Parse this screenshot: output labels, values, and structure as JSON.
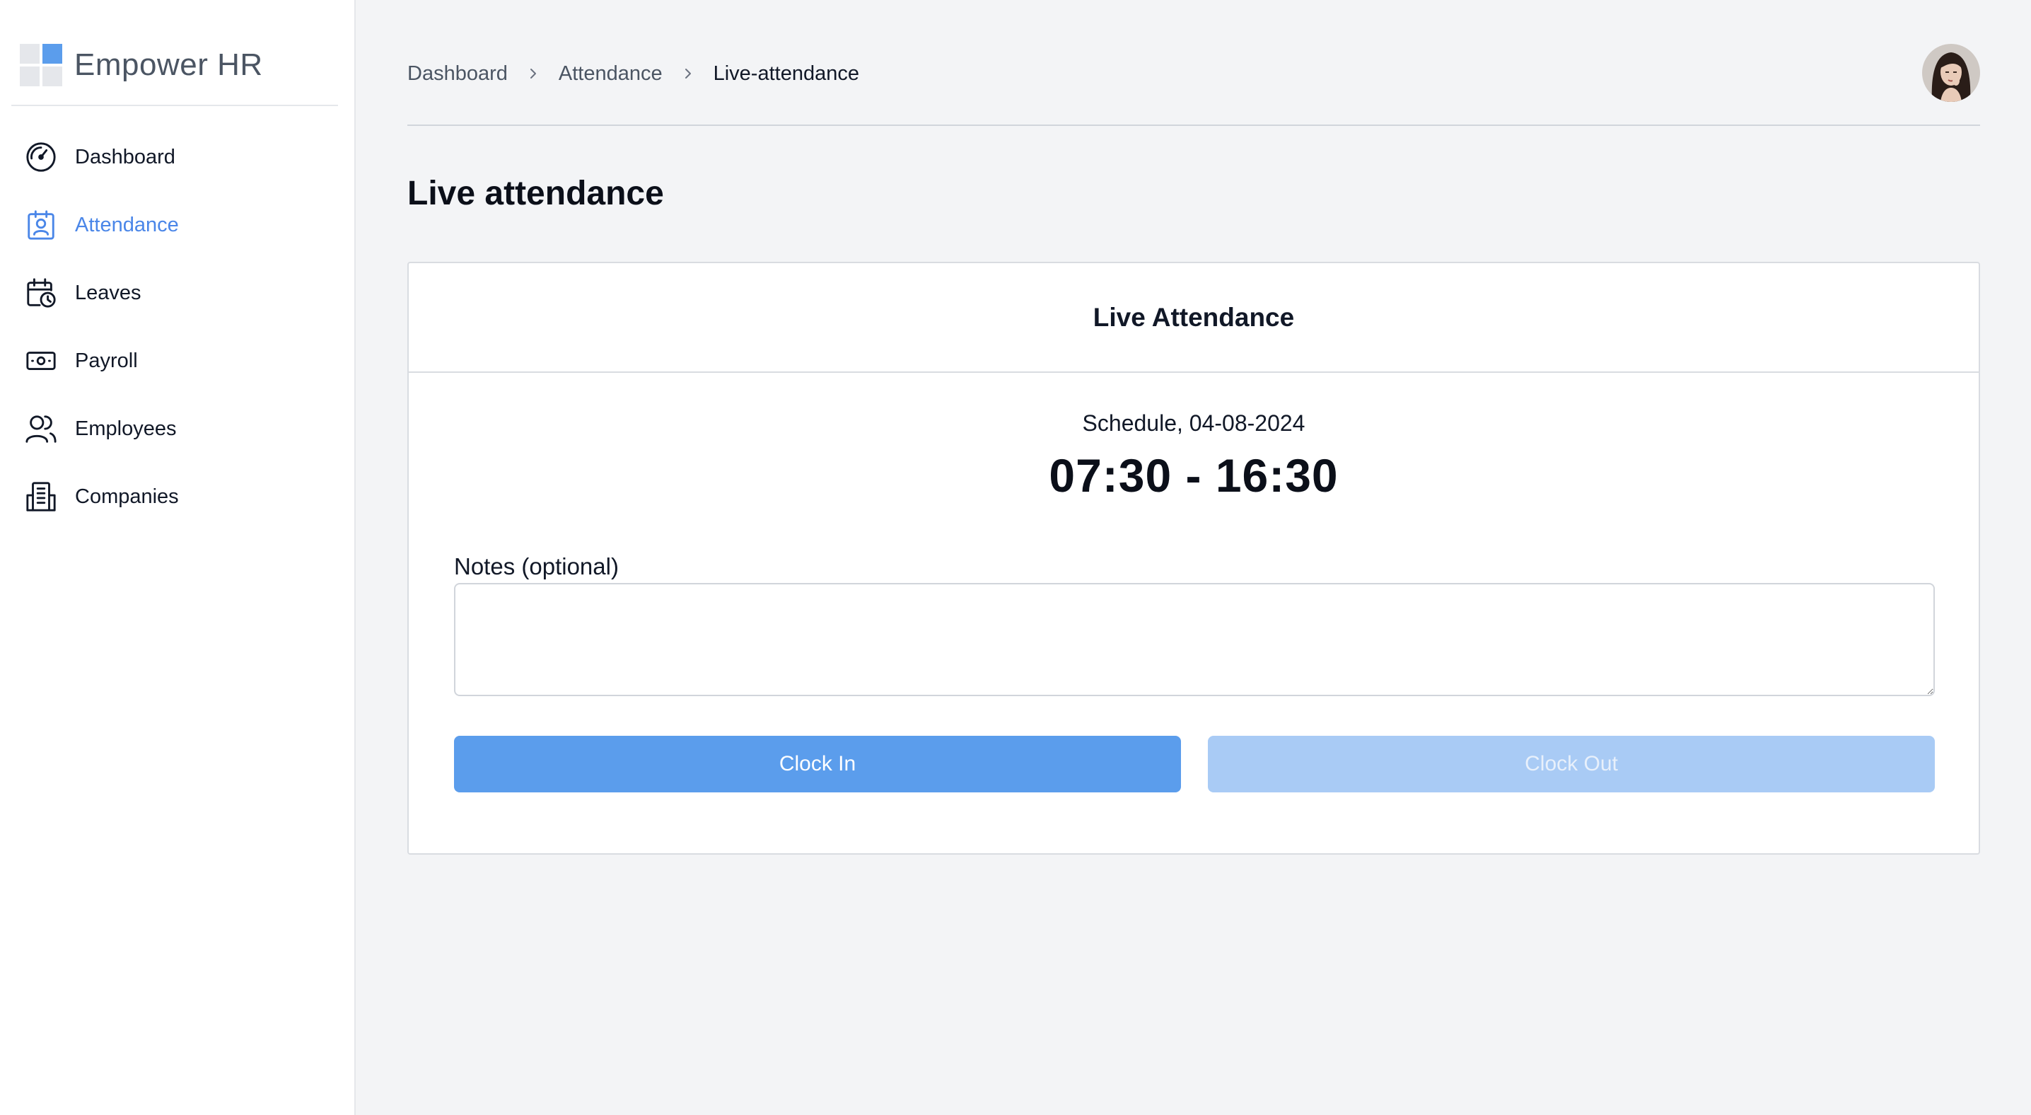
{
  "app": {
    "brand_name": "Empower HR"
  },
  "sidebar": {
    "items": [
      {
        "label": "Dashboard",
        "icon": "gauge-icon",
        "active": false
      },
      {
        "label": "Attendance",
        "icon": "attendance-badge-icon",
        "active": true
      },
      {
        "label": "Leaves",
        "icon": "calendar-clock-icon",
        "active": false
      },
      {
        "label": "Payroll",
        "icon": "banknote-icon",
        "active": false
      },
      {
        "label": "Employees",
        "icon": "users-icon",
        "active": false
      },
      {
        "label": "Companies",
        "icon": "building-icon",
        "active": false
      }
    ]
  },
  "breadcrumb": {
    "items": [
      "Dashboard",
      "Attendance",
      "Live-attendance"
    ]
  },
  "page": {
    "title": "Live attendance"
  },
  "card": {
    "title": "Live Attendance",
    "schedule_label": "Schedule, 04-08-2024",
    "time_range": "07:30 - 16:30",
    "notes_label": "Notes (optional)",
    "notes_value": "",
    "clock_in_label": "Clock In",
    "clock_out_label": "Clock Out"
  },
  "colors": {
    "accent": "#4a86e8",
    "clock_in_bg": "#5b9dec",
    "clock_out_bg": "#a9cbf5",
    "page_bg": "#f3f4f6"
  }
}
